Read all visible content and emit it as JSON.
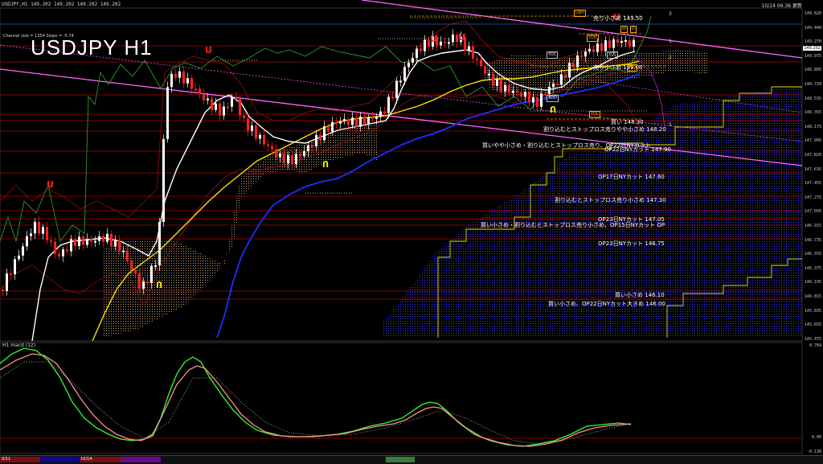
{
  "window": {
    "title": "USDJPY,H1  149.202 149.202 149.202 149.202",
    "datetime": "10/14 06:36 更新",
    "channel_info": "Channel size = 1354 Slope = -5.74",
    "big_title": "USDJPY H1",
    "macd_label": "H1  macd (12)"
  },
  "price_axis": [
    "149.620",
    "149.440",
    "149.270",
    "149.075",
    "148.895",
    "148.720",
    "148.535",
    "148.355",
    "148.175",
    "147.995",
    "147.820",
    "147.635",
    "147.455",
    "147.275",
    "147.095",
    "146.915",
    "146.735",
    "146.555",
    "146.375",
    "146.195",
    "146.015",
    "145.835",
    "145.655",
    "145.475"
  ],
  "current_price": "149.202",
  "macd_axis": [
    "0.764",
    "0.00",
    "-0.130"
  ],
  "orders": [
    {
      "id": "o1",
      "text": "売り小さめ 149.50"
    },
    {
      "id": "o2",
      "text": "売り小さめ 149.00"
    },
    {
      "id": "o3",
      "text": "買い 148.30"
    },
    {
      "id": "o4",
      "text": "割り込むとストップロス売りやや小さめ 148.20"
    },
    {
      "id": "o5",
      "text": "買いやや小さめ・割り込むとストップロス売り、OP22日NYカット"
    },
    {
      "id": "o6",
      "text": "OP22日NYカット 147.90"
    },
    {
      "id": "o7",
      "text": "OP17日NYカット 147.60"
    },
    {
      "id": "o8",
      "text": "割り込むとストップロス売り小さめ 147.30"
    },
    {
      "id": "o9",
      "text": "OP23日NYカット 147.05"
    },
    {
      "id": "o10",
      "text": "買い小さめ・割り込むとストップロス売り小さめ、OP15日NYカット OP"
    },
    {
      "id": "o11",
      "text": "OP23日NYカット 146.75"
    },
    {
      "id": "o12",
      "text": "買い小さめ 146.10"
    },
    {
      "id": "o13",
      "text": "買い小さめ、OP22日NYカット大きめ 146.00"
    }
  ],
  "tags": {
    "lwh": "LWH",
    "wbox": "W",
    "dbox": "D",
    "ydc1": "YDC",
    "ydo": "YDO",
    "ydl": "YDL",
    "ydh": "YDH",
    "ydc2": "YDC",
    "wd": "WD"
  },
  "fibo": {
    "f1": "1",
    "f2": "2",
    "f3": "3",
    "f5": "5"
  },
  "bottom": {
    "d1": "0/11",
    "d2": "10/14"
  },
  "colors": {
    "background": "#000000",
    "bull_candle": "#ffffff",
    "bear_candle": "#ff2020",
    "ma_fast": "#ffffff",
    "ma_mid": "#ffe000",
    "ma_slow": "#2030ff",
    "channel": "#ff66ff",
    "macd": "#30ff30",
    "signal": "#ff9090"
  }
}
